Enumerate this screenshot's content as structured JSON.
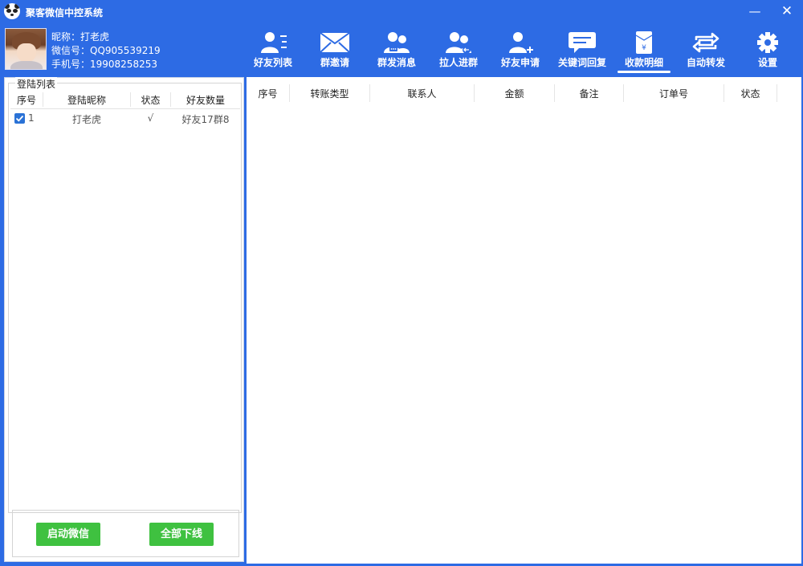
{
  "window": {
    "title": "聚客微信中控系统",
    "minimize": "—",
    "close": "✕"
  },
  "profile": {
    "nickname_line": "昵称：打老虎",
    "wechat_line": "微信号：QQ905539219",
    "phone_line": "手机号：19908258253"
  },
  "toolbar": [
    {
      "label": "好友列表",
      "icon": "friends-list-icon"
    },
    {
      "label": "群邀请",
      "icon": "group-invite-icon"
    },
    {
      "label": "群发消息",
      "icon": "mass-message-icon"
    },
    {
      "label": "拉人进群",
      "icon": "pull-into-group-icon"
    },
    {
      "label": "好友申请",
      "icon": "friend-request-icon"
    },
    {
      "label": "关键词回复",
      "icon": "keyword-reply-icon"
    },
    {
      "label": "收款明细",
      "icon": "payment-details-icon",
      "active": true
    },
    {
      "label": "自动转发",
      "icon": "auto-forward-icon"
    },
    {
      "label": "设置",
      "icon": "gear-icon"
    }
  ],
  "login_list": {
    "legend": "登陆列表",
    "columns": [
      "序号",
      "登陆昵称",
      "状态",
      "好友数量"
    ],
    "rows": [
      {
        "index": "1",
        "nickname": "打老虎",
        "status": "√",
        "friends": "好友17群8",
        "checked": true
      }
    ],
    "start_button": "启动微信",
    "offline_button": "全部下线"
  },
  "payments_table": {
    "columns": [
      "序号",
      "转账类型",
      "联系人",
      "金额",
      "备注",
      "订单号",
      "状态"
    ],
    "rows": []
  },
  "colors": {
    "titlebar": "#2d6be4",
    "green_button": "#3fc140",
    "checkbox": "#2a72d6"
  }
}
